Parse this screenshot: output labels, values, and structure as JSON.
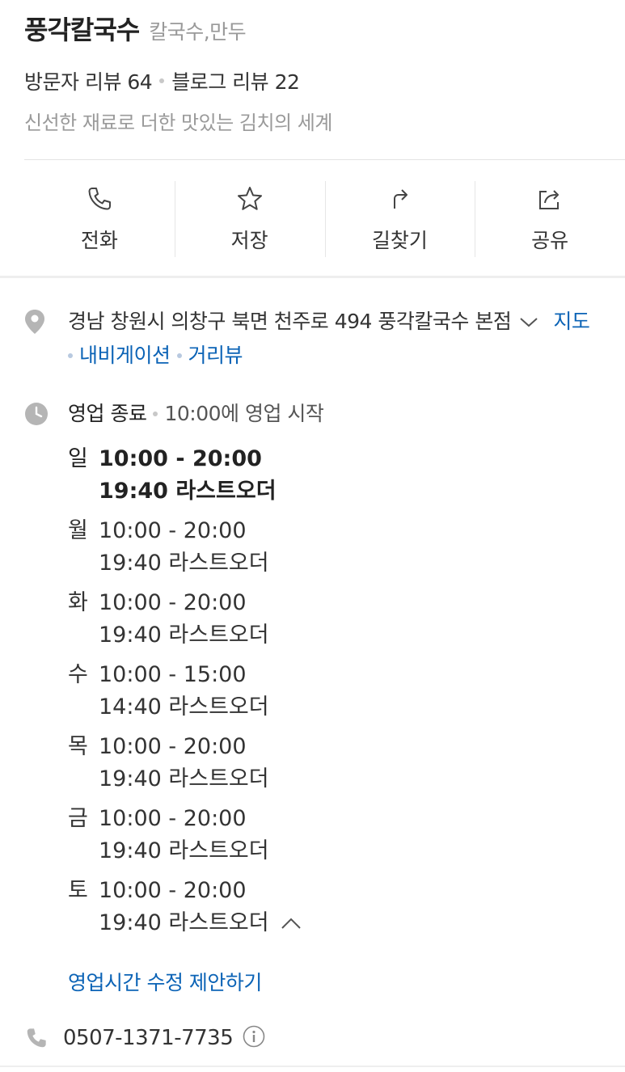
{
  "place": {
    "name": "풍각칼국수",
    "category": "칼국수,만두",
    "visitor_review": "방문자 리뷰 64",
    "blog_review": "블로그 리뷰 22",
    "description": "신선한 재료로 더한 맛있는 김치의 세계"
  },
  "actions": [
    {
      "label": "전화",
      "icon": "phone-icon"
    },
    {
      "label": "저장",
      "icon": "star-icon"
    },
    {
      "label": "길찾기",
      "icon": "directions-icon"
    },
    {
      "label": "공유",
      "icon": "share-icon"
    }
  ],
  "address": {
    "text": "경남 창원시 의창구 북면 천주로 494 풍각칼국수 본점",
    "map_link": "지도",
    "navigation_link": "내비게이션",
    "street_view_link": "거리뷰"
  },
  "hours": {
    "status": "영업 종료",
    "next_open": "10:00에 영업 시작",
    "days": [
      {
        "day": "일",
        "time": "10:00 - 20:00",
        "last_order": "19:40 라스트오더",
        "today": true
      },
      {
        "day": "월",
        "time": "10:00 - 20:00",
        "last_order": "19:40 라스트오더"
      },
      {
        "day": "화",
        "time": "10:00 - 20:00",
        "last_order": "19:40 라스트오더"
      },
      {
        "day": "수",
        "time": "10:00 - 15:00",
        "last_order": "14:40 라스트오더"
      },
      {
        "day": "목",
        "time": "10:00 - 20:00",
        "last_order": "19:40 라스트오더"
      },
      {
        "day": "금",
        "time": "10:00 - 20:00",
        "last_order": "19:40 라스트오더"
      },
      {
        "day": "토",
        "time": "10:00 - 20:00",
        "last_order": "19:40 라스트오더"
      }
    ],
    "suggest_edit": "영업시간 수정 제안하기"
  },
  "phone": {
    "number": "0507-1371-7735"
  },
  "colors": {
    "link": "#0b63b6",
    "icon_gray": "#b5b5b5",
    "muted_text": "#999999"
  }
}
